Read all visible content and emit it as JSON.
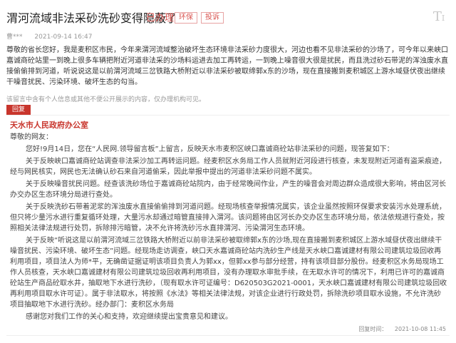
{
  "header": {
    "title": "渭河流域非法采砂洗砂变得隐蔽了",
    "status": "已办理",
    "tags": [
      "环保",
      "投诉"
    ],
    "corner_icon": "text-size-icon"
  },
  "meta": {
    "author": "曹***",
    "date": "2021-09-14 16:47"
  },
  "question": {
    "p1": "尊敬的省长您好，我是麦积区市民，今年来渭河流域整治破坏生态环境非法采砂力度很大，河边也看不见非法采砂的沙场了，可今年以来峡口嘉诚商砼站里一到晚上很多车辆把附近河道非法采的沙场料运进去加工再转运，一到晚上噪音很大很是扰民，而且洗过砂石带泥的浑浊废水直接偷偷排到河道，听说说这是以前渭河流域三岔铁路大桥附近以非法采砂被取缔郭x东的沙场，现在直接搬到麦积城区上游水域昼伏夜出继续干噪音扰民、污染环境、破坏生态的勾当。"
  },
  "disclaimer": "该留言中含有个人信息或其他不便公开展示的内容，仅办理机构可见。",
  "reply": {
    "button": "回复",
    "org": "天水市人民政府办公室",
    "greeting": "尊敬的网友：",
    "paragraphs": [
      "您好!9月14日，您在“人民网.领导留言板”上留言，反映天水市麦积区峡口嘉诚商砼站非法采砂的问题，现答复如下：",
      "关于反映峡口嘉诚商砼站调查非法采沙加工再转运问题。经麦积区水务局工作人员就附近河段进行核查，未发现附近河道有盗采痕迹，经与网民核实，网民也无法确认砂石来自河道偷采，因此举报中提出的河道非法采砂问题不属实。",
      "关于反映噪音扰民问题。经查该洗砂场位于嘉诚商砼站院内，由于经常晚间作业，产生的噪音会对周边群众造成很大影响，将由区河长办交办区生态环境分局进行查处。",
      "关于反映洗砂石带着泥浆的浑浊废水直接偷偷排到河道问题。经现场核查举报情况属实，该企业虽然按照环保要求安装污水处理系统，但只将少量污水进行重复循环处理，大量污水却通过暗管直接排入渭河。该问题将由区河长办交办区生态环境分局，依法依规进行查处，按照相关法律法规进行处罚，拆除排污暗管，决不允许将洗砂污水直排渭河、污染渭河生态环境。",
      "关于反映“听说这是以前渭河流域三岔铁路大桥附近以前非法采砂被取缔郭x东的沙场,现在直接搬到麦积城区上游水域昼伏夜出继续干噪音扰民、污染环境、破坏生态”问题。经现场走访调查，峡口天水嘉诚商砼站内洗砂生产线是天水峡口嘉诚建材有限公司建筑垃圾回收再利用项目，项目法人为师*平，无确凿证据证明该项目负责人为郭xx，但郭xx参与部分经营，持有该项目部分股份。经麦积区水务局现场工作人员核查，天水峡口嘉诚建材有限公司建筑垃圾回收再利用项目，没有办理取水审批手续，在无取水许可的情况下，利用已许可的嘉诚商砼站生产商品砼取水井，抽取地下水进行洗砂，（现有取水许可证编号：D620503G2021-0001，天水峡口嘉诚建材有限公司建筑垃圾回收再利用项目取水许可证）。属于非法取水，将按照《水法》等相关法律法规，对该企业进行行政处罚，拆除洗砂项目取水设施，不允许洗砂项目抽取地下水进行洗砂。经办部门：麦积区水务局",
      "感谢您对我们工作的关心和支持，欢迎继续提出宝贵意见和建议。"
    ],
    "time_label": "回复时间：",
    "time": "2021-10-08 11:45"
  }
}
